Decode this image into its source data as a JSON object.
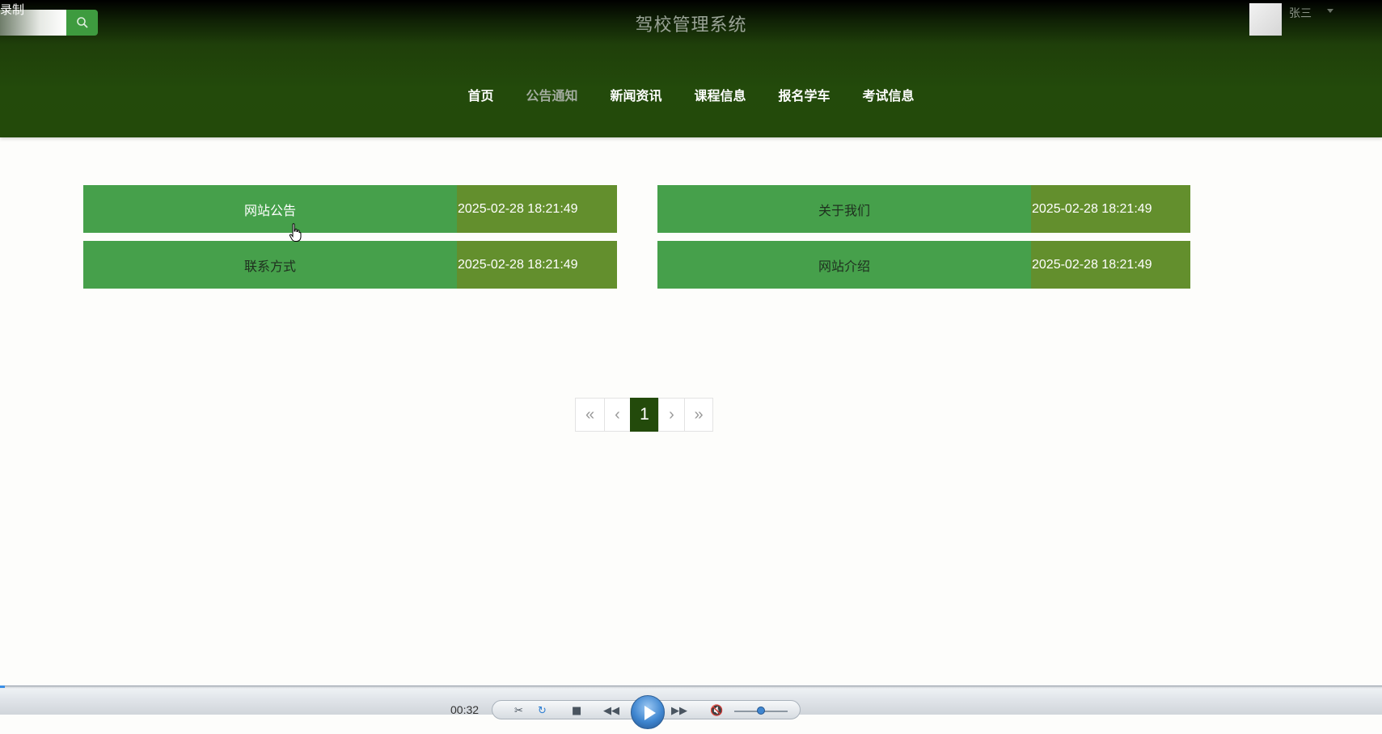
{
  "overlay": {
    "record_label": "录制"
  },
  "header": {
    "title": "驾校管理系统",
    "search": {
      "placeholder": "",
      "icon": "search-icon"
    },
    "user": {
      "name": "张三",
      "avatar_icon": "user-avatar"
    }
  },
  "nav": {
    "items": [
      {
        "label": "首页",
        "active": false
      },
      {
        "label": "公告通知",
        "active": true
      },
      {
        "label": "新闻资讯",
        "active": false
      },
      {
        "label": "课程信息",
        "active": false
      },
      {
        "label": "报名学车",
        "active": false
      },
      {
        "label": "考试信息",
        "active": false
      }
    ]
  },
  "notices": [
    {
      "title": "网站公告",
      "date": "2025-02-28 18:21:49"
    },
    {
      "title": "关于我们",
      "date": "2025-02-28 18:21:49"
    },
    {
      "title": "联系方式",
      "date": "2025-02-28 18:21:49"
    },
    {
      "title": "网站介绍",
      "date": "2025-02-28 18:21:49"
    }
  ],
  "pagination": {
    "first": "«",
    "prev": "‹",
    "current": "1",
    "next": "›",
    "last": "»"
  },
  "player": {
    "time": "00:32"
  },
  "colors": {
    "header_dark": "#234a0b",
    "card_title_bg": "#46a04b",
    "card_date_bg": "#638f2d",
    "search_button": "#3e9b3f"
  }
}
